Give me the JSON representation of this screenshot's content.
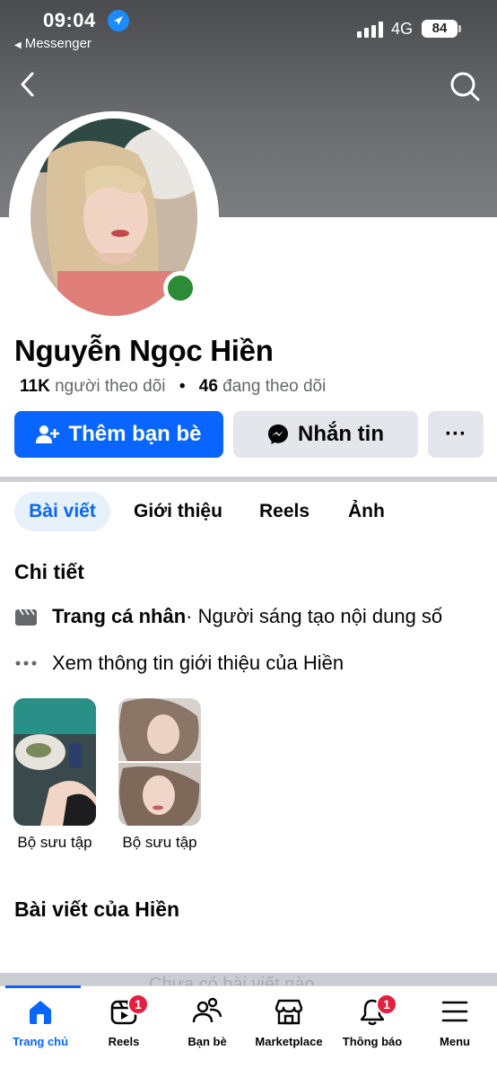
{
  "status_bar": {
    "time": "09:04",
    "back_app": "Messenger",
    "network": "4G",
    "battery": "84"
  },
  "profile": {
    "name": "Nguyễn Ngọc Hiền",
    "followers_count": "11K",
    "followers_label": "người theo dõi",
    "separator": "•",
    "following_count": "46",
    "following_label": "đang theo dõi",
    "online_color": "#2d8a35"
  },
  "actions": {
    "add_friend": "Thêm bạn bè",
    "message": "Nhắn tin",
    "more": "···"
  },
  "tabs": [
    {
      "label": "Bài viết",
      "active": true
    },
    {
      "label": "Giới thiệu",
      "active": false
    },
    {
      "label": "Reels",
      "active": false
    },
    {
      "label": "Ảnh",
      "active": false
    }
  ],
  "details": {
    "title": "Chi tiết",
    "page_type": "Trang cá nhân",
    "page_category": " · Người sáng tạo nội dung số",
    "see_about": "Xem thông tin giới thiệu của Hiền"
  },
  "collections": [
    {
      "label": "Bộ sưu tập"
    },
    {
      "label": "Bộ sưu tập"
    }
  ],
  "posts": {
    "title": "Bài viết của Hiền",
    "composer_hint": "Chưa có bài viết nào"
  },
  "bottom_nav": [
    {
      "label": "Trang chủ",
      "icon": "home-icon",
      "active": true,
      "badge": ""
    },
    {
      "label": "Reels",
      "icon": "reels-icon",
      "active": false,
      "badge": "1"
    },
    {
      "label": "Bạn bè",
      "icon": "friends-icon",
      "active": false,
      "badge": ""
    },
    {
      "label": "Marketplace",
      "icon": "marketplace-icon",
      "active": false,
      "badge": ""
    },
    {
      "label": "Thông báo",
      "icon": "bell-icon",
      "active": false,
      "badge": "1"
    },
    {
      "label": "Menu",
      "icon": "menu-icon",
      "active": false,
      "badge": ""
    }
  ],
  "colors": {
    "brand_blue": "#0866ff",
    "badge_red": "#e41e3f"
  }
}
